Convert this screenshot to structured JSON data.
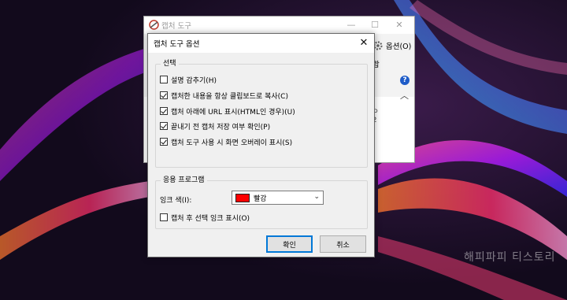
{
  "colors": {
    "ink": "#ff0000",
    "focus": "#0078d7",
    "help_icon": "#1e5cc8"
  },
  "background_window": {
    "title": "캡처 도구",
    "options_label": "옵션(O)",
    "truncated_mode_text": "합",
    "truncated_bottom_text": "ㅇ\n2",
    "icons": [
      "app-icon",
      "minimize-icon",
      "maximize-icon",
      "close-icon",
      "gear-icon",
      "help-icon",
      "chevron-up-icon"
    ]
  },
  "dialog": {
    "title": "캡처 도구 옵션",
    "close_symbol": "✕",
    "selection_group": {
      "label": "선택",
      "options": [
        {
          "label": "설명 감추기(H)",
          "checked": false
        },
        {
          "label": "캡처한 내용을 항상 클립보드로 복사(C)",
          "checked": true
        },
        {
          "label": "캡처 아래에 URL 표시(HTML인 경우)(U)",
          "checked": true
        },
        {
          "label": "끝내기 전 캡처 저장 여부 확인(P)",
          "checked": true
        },
        {
          "label": "캡처 도구 사용 시 화면 오버레이 표시(S)",
          "checked": true
        }
      ]
    },
    "app_group": {
      "label": "응용 프로그램",
      "ink_color_label": "잉크 색(I):",
      "ink_color_value": "빨강",
      "show_ink_label": "캡처 후 선택 잉크 표시(O)",
      "show_ink_checked": false
    },
    "ok_label": "확인",
    "cancel_label": "취소"
  },
  "watermark": "해피파피 티스토리"
}
